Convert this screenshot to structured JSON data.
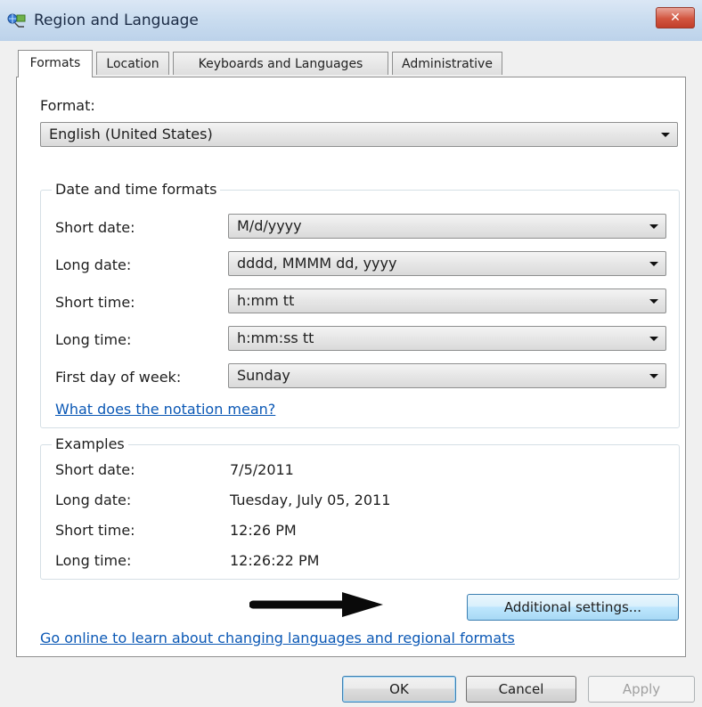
{
  "window": {
    "title": "Region and Language",
    "close_glyph": "✕"
  },
  "tabs": [
    {
      "label": "Formats",
      "active": true
    },
    {
      "label": "Location",
      "active": false
    },
    {
      "label": "Keyboards and Languages",
      "active": false
    },
    {
      "label": "Administrative",
      "active": false
    }
  ],
  "format": {
    "label": "Format:",
    "value": "English (United States)"
  },
  "date_time": {
    "title": "Date and time formats",
    "rows": [
      {
        "label": "Short date:",
        "value": "M/d/yyyy"
      },
      {
        "label": "Long date:",
        "value": "dddd, MMMM dd, yyyy"
      },
      {
        "label": "Short time:",
        "value": "h:mm tt"
      },
      {
        "label": "Long time:",
        "value": "h:mm:ss tt"
      },
      {
        "label": "First day of week:",
        "value": "Sunday"
      }
    ],
    "notation_link": "What does the notation mean?"
  },
  "examples": {
    "title": "Examples",
    "rows": [
      {
        "label": "Short date:",
        "value": "7/5/2011"
      },
      {
        "label": "Long date:",
        "value": "Tuesday, July 05, 2011"
      },
      {
        "label": "Short time:",
        "value": "12:26 PM"
      },
      {
        "label": "Long time:",
        "value": "12:26:22 PM"
      }
    ]
  },
  "additional_settings": "Additional settings...",
  "online_link": "Go online to learn about changing languages and regional formats",
  "footer": {
    "ok": "OK",
    "cancel": "Cancel",
    "apply": "Apply"
  },
  "icons": {
    "app": "globe-network-icon",
    "dropdown": "chevron-down-icon",
    "annotation": "arrow-right-icon"
  },
  "colors": {
    "link": "#0b58b5",
    "titlebar": "#c9dcef",
    "close": "#c13e2a"
  }
}
